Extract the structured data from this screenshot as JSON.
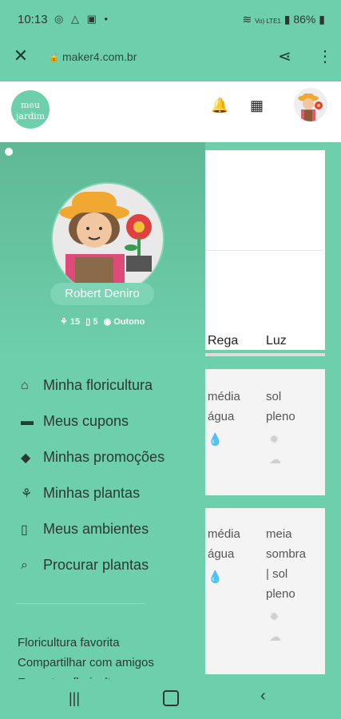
{
  "status": {
    "time": "10:13",
    "battery": "86%",
    "signal_label": "Vo) LTE1"
  },
  "browser": {
    "url": "maker4.com.br"
  },
  "header": {
    "logo_text": "meu jardim"
  },
  "table": {
    "headers": [
      "Rega",
      "Luz"
    ],
    "rows": [
      {
        "rega": [
          "média",
          "água"
        ],
        "luz": [
          "sol",
          "pleno"
        ]
      },
      {
        "rega": [
          "média",
          "água"
        ],
        "luz": [
          "meia",
          "sombra",
          "| sol",
          "pleno"
        ]
      }
    ]
  },
  "drawer": {
    "user_name": "Robert Deniro",
    "stats": {
      "plants": "15",
      "rooms": "5",
      "season": "Outono"
    },
    "menu": [
      {
        "label": "Minha floricultura",
        "icon": "store-icon"
      },
      {
        "label": "Meus cupons",
        "icon": "ticket-icon"
      },
      {
        "label": "Minhas promoções",
        "icon": "tags-icon"
      },
      {
        "label": "Minhas plantas",
        "icon": "seedling-icon"
      },
      {
        "label": "Meus ambientes",
        "icon": "door-icon"
      },
      {
        "label": "Procurar plantas",
        "icon": "search-icon"
      }
    ],
    "footer_links": [
      "Floricultura favorita",
      "Compartilhar com amigos",
      "Encontrar floricultura"
    ]
  },
  "colors": {
    "primary": "#6ecfac",
    "accent": "#5fb895"
  }
}
